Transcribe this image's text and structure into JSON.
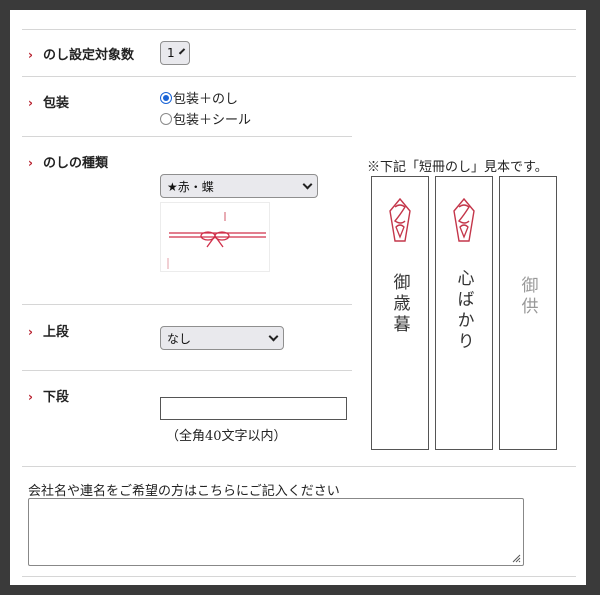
{
  "rows": {
    "count": {
      "label": "のし設定対象数",
      "select_value": "1"
    },
    "wrapping": {
      "label": "包装",
      "options": [
        {
          "text": "包装＋のし",
          "checked": true
        },
        {
          "text": "包装＋シール",
          "checked": false
        }
      ]
    },
    "type": {
      "label": "のしの種類",
      "select_value": "★赤・蝶"
    },
    "upper": {
      "label": "上段",
      "select_value": "なし"
    },
    "lower": {
      "label": "下段",
      "input_value": "",
      "hint": "（全角40文字以内）"
    }
  },
  "sample": {
    "caption": "※下記「短冊のし」見本です。",
    "cards": [
      {
        "text": "御歳暮",
        "crest": true,
        "color": "#333333"
      },
      {
        "text": "心ばかり",
        "crest": true,
        "color": "#333333"
      },
      {
        "text": "御供",
        "crest": false,
        "color": "#999999"
      }
    ]
  },
  "company": {
    "label": "会社名や連名をご希望の方はこちらにご記入ください",
    "value": ""
  },
  "icons": {
    "row_marker": "chevron-right-icon",
    "select_arrow": "chevron-down-icon"
  },
  "colors": {
    "accent": "#b8202e",
    "crest": "#c4364a",
    "radio": "#1a64d6"
  }
}
